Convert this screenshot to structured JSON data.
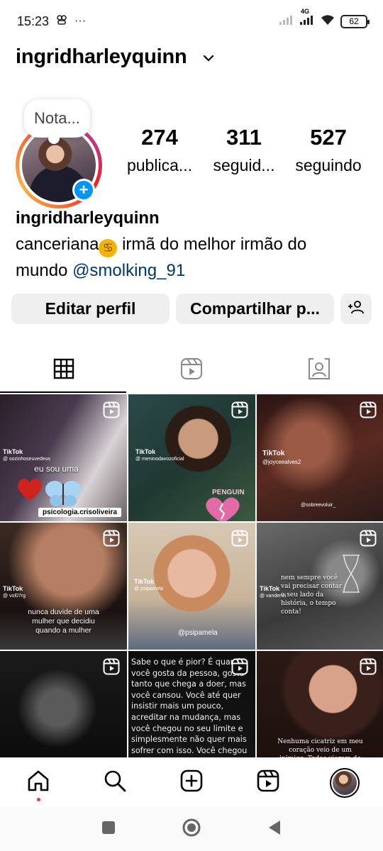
{
  "status_bar": {
    "time": "15:23",
    "network": "4G",
    "battery": "62"
  },
  "header": {
    "username": "ingridharleyquinn"
  },
  "profile": {
    "note": "Nota...",
    "stats": [
      {
        "value": "274",
        "label": "publica..."
      },
      {
        "value": "311",
        "label": "seguid..."
      },
      {
        "value": "527",
        "label": "seguindo"
      }
    ],
    "name": "ingridharleyquinn",
    "bio_line1_prefix": "canceriana",
    "zodiac_glyph": "♋",
    "bio_line1_suffix": " irmã do melhor irmão do",
    "bio_line2_prefix": "mundo ",
    "mention": "@smolking_91"
  },
  "actions": {
    "edit": "Editar perfil",
    "share": "Compartilhar p..."
  },
  "tabs": [
    "grid-icon",
    "reels-icon",
    "tagged-icon"
  ],
  "grid": {
    "posts": [
      {
        "caption": "eu sou uma",
        "tiktok": "TikTok",
        "handle": "@ sozinhoseuvedeus",
        "footer": "psicologia.crisoliveira"
      },
      {
        "caption": "",
        "tiktok": "TikTok",
        "handle": "@ meninodavozoficial",
        "footer": "PENGUIN"
      },
      {
        "caption": "",
        "tiktok": "TikTok",
        "handle": "@joyceealves2",
        "footer": "@sobreevoluir_"
      },
      {
        "caption": "nunca duvide de uma mulher que decidiu quando a mulher",
        "tiktok": "TikTok",
        "handle": "@ vol07rg",
        "footer": ""
      },
      {
        "caption": "",
        "tiktok": "TikTok",
        "handle": "@ psipamela",
        "footer": "@psipamela"
      },
      {
        "caption": "nem sempre você vai precisar contar o seu lado da história, o tempo conta!",
        "tiktok": "TikTok",
        "handle": "@ vanderlei",
        "footer": ""
      },
      {
        "caption": "",
        "tiktok": "",
        "handle": "",
        "footer": ""
      },
      {
        "caption": "Sabe o que é pior?\nÉ quando você gosta da pessoa, gosta tanto que chega a doer, mas você cansou. Você até quer insistir mais um pouco, acreditar na mudança, mas você chegou no seu limite e simplesmente não quer mais sofrer com isso. Você chegou no ponto que apenas decidiu que",
        "tiktok": "",
        "handle": "",
        "footer": ""
      },
      {
        "caption": "Nenhuma cicatriz em meu coração veio de um inimigo. Todas vieram de pessoas que disseram me amar.",
        "tiktok": "",
        "handle": "",
        "footer": ""
      }
    ]
  },
  "bottom_nav": [
    "home-icon",
    "search-icon",
    "create-icon",
    "reels-icon",
    "profile-avatar"
  ],
  "colors": {
    "accent_blue": "#0095f6",
    "mention": "#00376b",
    "notification_dot": "#ff3040"
  }
}
